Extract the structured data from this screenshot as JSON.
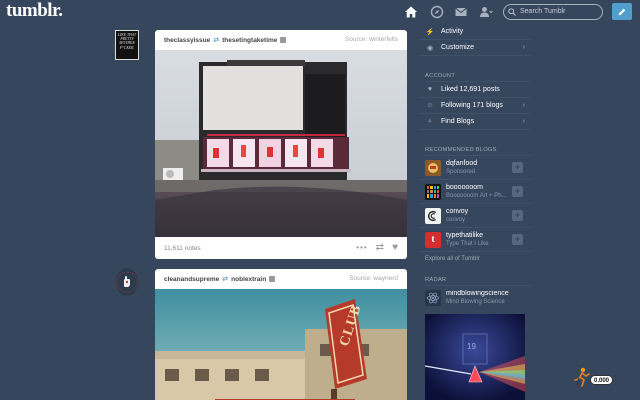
{
  "header": {
    "logo": "tumblr.",
    "search_placeholder": "Search Tumblr",
    "icons": [
      "home-icon",
      "compass-icon",
      "mail-icon",
      "account-icon",
      "search-icon",
      "pencil-icon"
    ]
  },
  "avatar1_text": "LIKE THAT PRETTY MOTHER F*CKER.",
  "posts": [
    {
      "reblogger": "theclassyissue",
      "reblogged_from": "thesetingtaketime",
      "source": "Source: winterfells",
      "notes": "11,611 notes"
    },
    {
      "reblogger": "cleanandsupreme",
      "reblogged_from": "noblextrain",
      "source": "Source: waynerd",
      "sign_text": "CLUB"
    }
  ],
  "sidebar": {
    "top_items": [
      {
        "label": "Activity",
        "icon": "lightning-icon"
      },
      {
        "label": "Customize",
        "icon": "eye-icon"
      }
    ],
    "account_title": "ACCOUNT",
    "account_items": [
      {
        "label": "Liked 12,691 posts",
        "icon": "heart-icon"
      },
      {
        "label": "Following 171 blogs",
        "icon": "user-plus-icon"
      },
      {
        "label": "Find Blogs",
        "icon": "search-icon"
      }
    ],
    "recommended_title": "RECOMMENDED BLOGS",
    "blogs": [
      {
        "name": "dqfanfood",
        "sub": "Sponsored"
      },
      {
        "name": "booooooom",
        "sub": "Booooooom Art + Ph..."
      },
      {
        "name": "convoy",
        "sub": "convoy"
      },
      {
        "name": "typethatilike",
        "sub": "Type That I Like"
      }
    ],
    "explore": "Explore all of Tumblr",
    "radar_title": "RADAR",
    "radar_blog": {
      "name": "mindblowingscience",
      "sub": "Mind Blowing Science"
    }
  },
  "stopwatch": "0.000",
  "colors": {
    "background": "#36465d",
    "accent": "#529ecc"
  }
}
